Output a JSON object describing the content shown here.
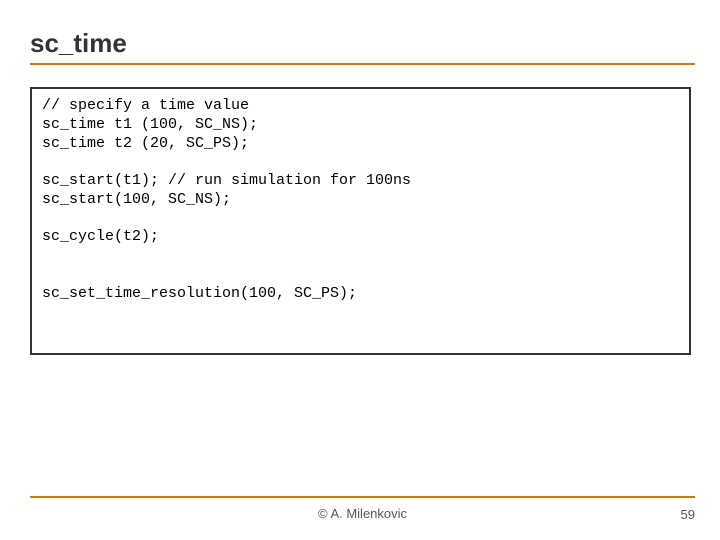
{
  "slide": {
    "title": "sc_time"
  },
  "code": {
    "block1": "// specify a time value\nsc_time t1 (100, SC_NS);\nsc_time t2 (20, SC_PS);",
    "block2": "sc_start(t1); // run simulation for 100ns\nsc_start(100, SC_NS);",
    "block3": "sc_cycle(t2);",
    "block4": "sc_set_time_resolution(100, SC_PS);"
  },
  "footer": {
    "author": "© A. Milenkovic",
    "page": "59"
  }
}
